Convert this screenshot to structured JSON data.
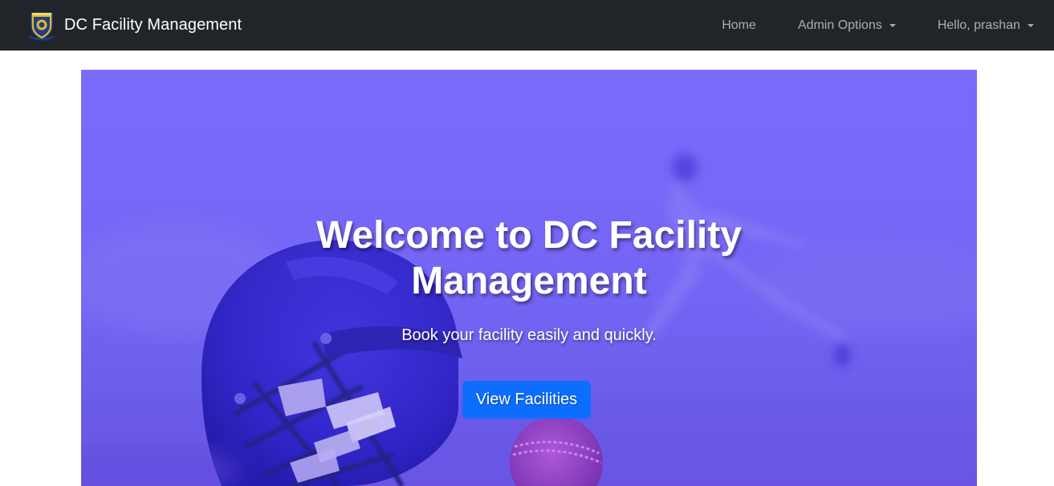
{
  "navbar": {
    "brand_title": "DC Facility Management",
    "logo_icon": "university-crest-icon",
    "links": {
      "home": "Home",
      "admin_options": "Admin Options",
      "user_greeting": "Hello, prashan"
    }
  },
  "hero": {
    "title": "Welcome to DC Facility Management",
    "subtitle": "Book your facility easily and quickly.",
    "cta_label": "View Facilities",
    "background_image": "cricket-helmet-and-ball-photo"
  },
  "colors": {
    "navbar_bg": "#212529",
    "hero_tint": "#7a6cf5",
    "button_primary": "#0d6efd"
  }
}
